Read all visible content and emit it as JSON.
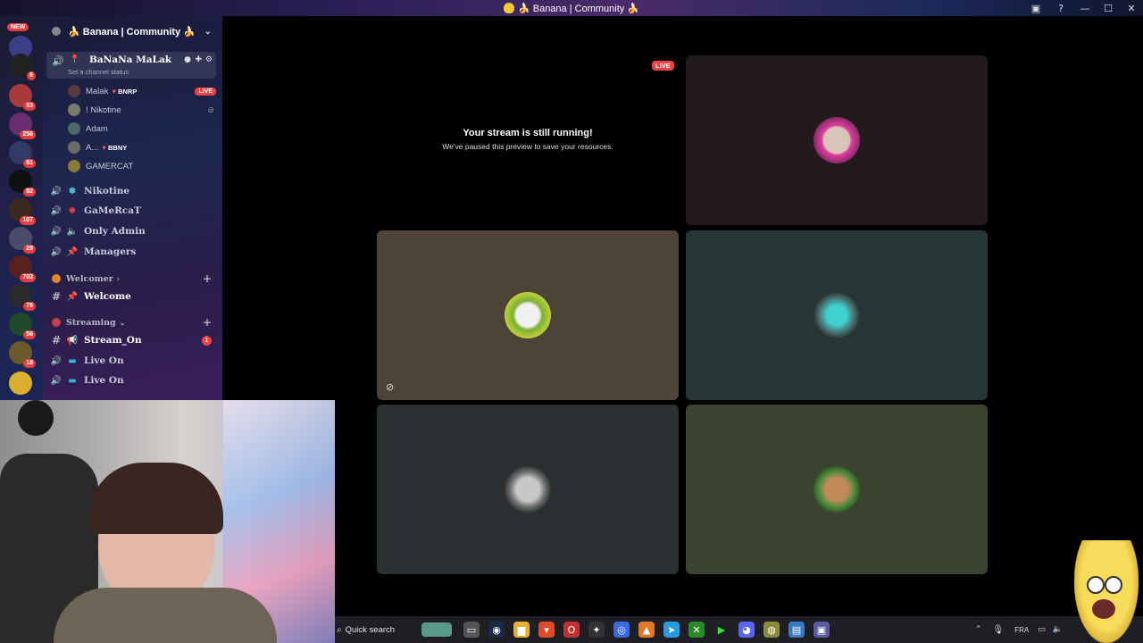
{
  "window": {
    "title": "🍌 Banana | Community 🍌"
  },
  "server_rail": {
    "new_label": "NEW",
    "badges": [
      "6",
      "53",
      "256",
      "61",
      "82",
      "107",
      "29",
      "703",
      "76",
      "56",
      "18"
    ]
  },
  "channel_panel": {
    "server_name": "🍌 Banana | Community 🍌",
    "active_voice": {
      "name": "BaNaNa MaLak",
      "status": "Set a channel status",
      "users": [
        {
          "name": "Malak",
          "tag": "BNRP",
          "live": "LIVE"
        },
        {
          "name": "! Nikotine"
        },
        {
          "name": "Adam"
        },
        {
          "name": "A...",
          "tag": "BBNY"
        },
        {
          "name": "GAMERCAT"
        }
      ]
    },
    "voice_channels": [
      "Nikotine",
      "GaMeRcaT",
      "Only Admin",
      "Managers"
    ],
    "categories": [
      {
        "name": "Welcomer",
        "channels": [
          {
            "name": "Welcome"
          }
        ]
      },
      {
        "name": "Streaming",
        "channels": [
          {
            "name": "Stream_On",
            "badge": "1"
          },
          {
            "name": "Live On"
          },
          {
            "name": "Live On"
          }
        ]
      }
    ]
  },
  "stage": {
    "live_label": "LIVE",
    "paused_title": "Your stream is still running!",
    "paused_subtitle": "We've paused this preview to save your resources."
  },
  "taskbar": {
    "search_placeholder": "Quick search",
    "language": "FRA"
  },
  "colors": {
    "live_red": "#ed4245",
    "tile_dark_brown": "#231b1b",
    "tile_tan": "#4d4437",
    "tile_teal": "#273534",
    "tile_slate": "#2b3033",
    "tile_olive": "#3a4330"
  }
}
